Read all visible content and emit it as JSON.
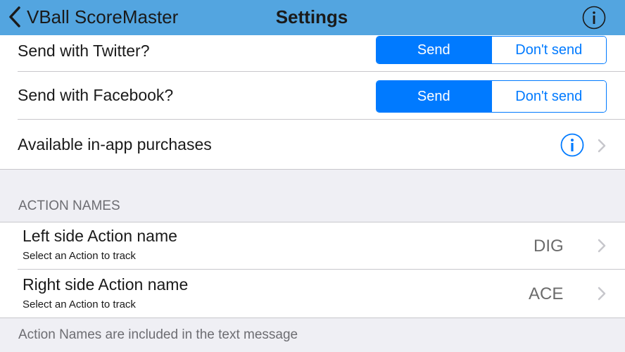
{
  "navbar": {
    "back_label": "VBall ScoreMaster",
    "title": "Settings",
    "info_icon": "info-icon"
  },
  "settings": {
    "twitter": {
      "label": "Send with Twitter?",
      "on_label": "Send",
      "off_label": "Don't send",
      "selected": "Send"
    },
    "facebook": {
      "label": "Send with Facebook?",
      "on_label": "Send",
      "off_label": "Don't send",
      "selected": "Send"
    },
    "purchases": {
      "label": "Available in-app purchases"
    }
  },
  "action_names": {
    "header": "ACTION NAMES",
    "left": {
      "title": "Left side Action name",
      "subtitle": "Select an Action to track",
      "value": "DIG"
    },
    "right": {
      "title": "Right side Action name",
      "subtitle": "Select an Action to track",
      "value": "ACE"
    },
    "footer": "Action Names are included in the text message"
  },
  "colors": {
    "navbar": "#53a5e0",
    "accent": "#007aff",
    "background": "#efeff4"
  }
}
